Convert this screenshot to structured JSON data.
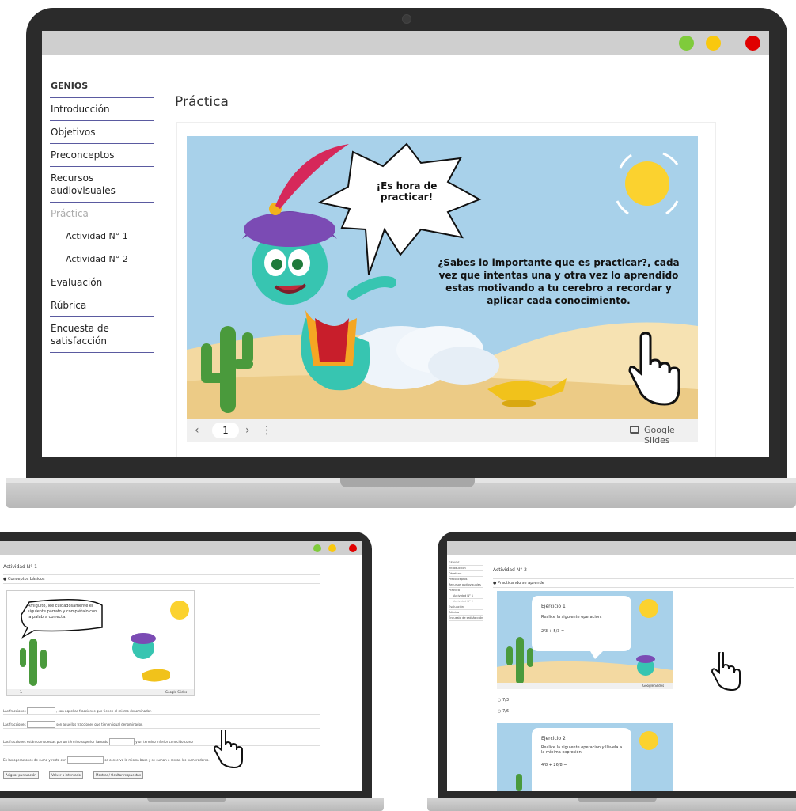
{
  "colors": {
    "close": "#e00000",
    "minimize": "#f9c80e",
    "maximize": "#7fcb3b",
    "sidebar_rule": "#5a5aa0",
    "slide_sky": "#a8d1ea"
  },
  "main": {
    "sidebar": {
      "items": [
        {
          "label": "GENIOS"
        },
        {
          "label": "Introducción"
        },
        {
          "label": "Objetivos"
        },
        {
          "label": "Preconceptos"
        },
        {
          "label": "Recursos audiovisuales"
        },
        {
          "label": "Práctica"
        },
        {
          "label": "Actividad N° 1"
        },
        {
          "label": "Actividad N° 2"
        },
        {
          "label": "Evaluación"
        },
        {
          "label": "Rúbrica"
        },
        {
          "label": "Encuesta de satisfacción"
        }
      ]
    },
    "page_title": "Práctica",
    "slide": {
      "bubble": "¡Es hora de practicar!",
      "body": "¿Sabes lo importante que es practicar?, cada vez que intentas una y otra vez lo aprendido estas motivando a tu cerebro a recordar y aplicar cada conocimiento."
    },
    "controls": {
      "prev": "‹",
      "page": "1",
      "next": "›",
      "more": "⋮",
      "brand": "Google Slides"
    }
  },
  "left": {
    "title": "Actividad N° 1",
    "section": "Conceptos básicos",
    "bubble": "Amiguito, lee cuidadosamente el siguiente párrafo y complétalo con la palabra correcta.",
    "controls_page": "1",
    "brand": "Google Slides",
    "sentences": [
      {
        "a": "Las fracciones",
        "b": ", son aquellas fracciones que tienen el mismo denominador."
      },
      {
        "a": "Las fracciones",
        "b": "son aquellas fracciones que tienen igual denominador."
      },
      {
        "a": "Las fracciones están compuestas por un término superior llamado",
        "b": "y un término inferior conocido como"
      },
      {
        "a": "En las operaciones de suma y resta con",
        "b": "se conserva la misma base y se suman o restan los numeradores."
      }
    ],
    "buttons": [
      "Asignar puntuación",
      "Volver a intentarlo",
      "Mostrar / Ocultar respuestas"
    ]
  },
  "right": {
    "sidebar": [
      "GENIOS",
      "Introducción",
      "Objetivos",
      "Preconceptos",
      "Recursos audiovisuales",
      "Práctica",
      "Actividad N° 1",
      "Actividad N° 2",
      "Evaluación",
      "Rúbrica",
      "Encuesta de satisfacción"
    ],
    "title": "Actividad N° 2",
    "section": "Practicando se aprende",
    "ex1": {
      "title": "Ejercicio 1",
      "prompt": "Realice la siguiente operación:",
      "expr": "2/3 + 5/3 ="
    },
    "options": [
      "7/3",
      "7/6"
    ],
    "ex2": {
      "title": "Ejercicio 2",
      "prompt": "Realice la siguiente operación y llévela a la mínima expresión:",
      "expr": "4/8 + 26/8 ="
    },
    "brand": "Google Slides"
  }
}
